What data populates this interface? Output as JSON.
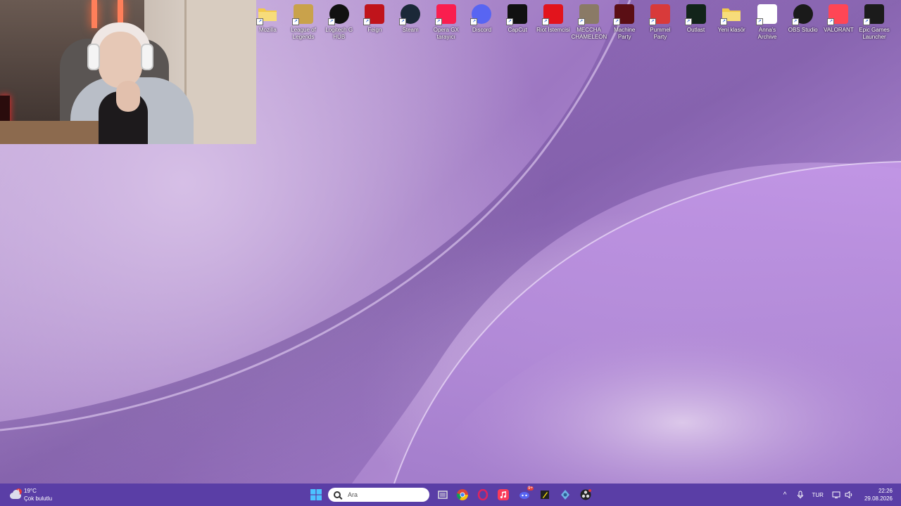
{
  "desktop": {
    "icons": [
      {
        "label": "Mozilla",
        "icon": "folder-icon",
        "color": "#f2c94c"
      },
      {
        "label": "League of Legends",
        "icon": "league-of-legends-icon",
        "color": "#c9a24b"
      },
      {
        "label": "Logitech G HUB",
        "icon": "logitech-g-hub-icon",
        "color": "#111111"
      },
      {
        "label": "Feign",
        "icon": "feign-icon",
        "color": "#c0141b"
      },
      {
        "label": "Steam",
        "icon": "steam-icon",
        "color": "#1b2838"
      },
      {
        "label": "Opera GX tarayıcı",
        "icon": "opera-gx-icon",
        "color": "#fa1e4e"
      },
      {
        "label": "Discord",
        "icon": "discord-icon",
        "color": "#5865f2"
      },
      {
        "label": "CapCut",
        "icon": "capcut-icon",
        "color": "#111111"
      },
      {
        "label": "Riot İstemcisi",
        "icon": "riot-client-icon",
        "color": "#e2141c"
      },
      {
        "label": "MECCHA CHAMELEON",
        "icon": "meccha-chameleon-icon",
        "color": "#8a7a66"
      },
      {
        "label": "Machine Party",
        "icon": "machine-party-icon",
        "color": "#5a0e14"
      },
      {
        "label": "Pummel Party",
        "icon": "pummel-party-icon",
        "color": "#d83a3a"
      },
      {
        "label": "Outlast",
        "icon": "outlast-icon",
        "color": "#12241a"
      },
      {
        "label": "Yeni klasör",
        "icon": "folder-icon",
        "color": "#f2c94c"
      },
      {
        "label": "Anna's Archive",
        "icon": "annas-archive-icon",
        "color": "#ffffff"
      },
      {
        "label": "OBS Studio",
        "icon": "obs-studio-icon",
        "color": "#1a1a1a"
      },
      {
        "label": "VALORANT",
        "icon": "valorant-icon",
        "color": "#ff4655"
      },
      {
        "label": "Epic Games Launcher",
        "icon": "epic-games-icon",
        "color": "#1b1b1b"
      }
    ]
  },
  "taskbar": {
    "weather": {
      "temp": "19°C",
      "condition": "Çok bulutlu",
      "badge": "1"
    },
    "search": {
      "placeholder": "Ara"
    },
    "pinned": [
      {
        "name": "task-view-icon"
      },
      {
        "name": "chrome-icon"
      },
      {
        "name": "opera-gx-icon"
      },
      {
        "name": "apple-music-icon"
      },
      {
        "name": "discord-icon",
        "badge": "9+"
      },
      {
        "name": "sticky-notes-icon"
      },
      {
        "name": "settings-app-icon"
      },
      {
        "name": "obs-studio-icon"
      }
    ],
    "tray": {
      "lang": "TUR",
      "time": "22:26",
      "date": "29.08.2026"
    }
  },
  "colors": {
    "taskbar": "#5a3ea6",
    "accent": "#b48fd6"
  }
}
